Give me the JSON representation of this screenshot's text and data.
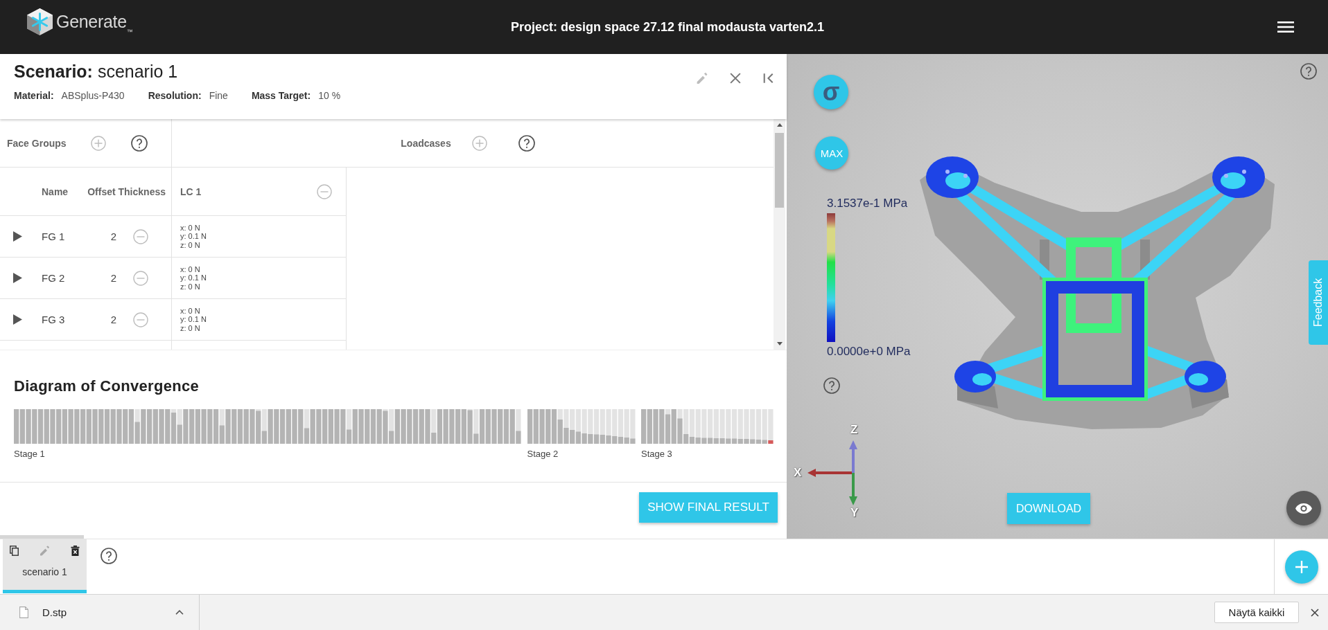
{
  "header": {
    "logo_text": "Generate",
    "logo_mark": "™",
    "title": "Project: design space 27.12 final modausta varten2.1"
  },
  "scenario": {
    "title": "**Scenario:** scenario 1",
    "meta": [
      {
        "label": "Material:",
        "value": "ABSplus-P430"
      },
      {
        "label": "Resolution:",
        "value": "Fine"
      },
      {
        "label": "Mass Target:",
        "value": "10 %"
      }
    ]
  },
  "face_groups": {
    "title": "Face Groups",
    "columns": [
      "Name",
      "Offset Thickness"
    ],
    "rows": [
      {
        "name": "FG 1",
        "offset_thickness": "2",
        "expanded": false
      },
      {
        "name": "FG 2",
        "offset_thickness": "2",
        "expanded": false
      },
      {
        "name": "FG 3",
        "offset_thickness": "2",
        "expanded": false
      }
    ]
  },
  "loadcases": {
    "title": "Loadcases",
    "columns": [
      {
        "label": "LC 1",
        "loads": [
          [
            "x: 0 N",
            "y: 0.1 N",
            "z: 0 N"
          ],
          [
            "x: 0 N",
            "y: 0.1 N",
            "z: 0 N"
          ],
          [
            "x: 0 N",
            "y: 0.1 N",
            "z: 0 N"
          ]
        ]
      }
    ]
  },
  "convergence": {
    "title": "Diagram of Convergence",
    "stages": [
      {
        "label": "Stage 1"
      },
      {
        "label": "Stage 2"
      },
      {
        "label": "Stage 3"
      }
    ],
    "button": "SHOW FINAL RESULT"
  },
  "viewer": {
    "stress_button": "σ",
    "max_button": "MAX",
    "legend": {
      "max_label": "3.1537e-1 MPa",
      "min_label": "0.0000e+0 MPa"
    },
    "axes": {
      "x": "X",
      "y": "Y",
      "z": "Z"
    },
    "download_button": "DOWNLOAD",
    "feedback_tab": "Feedback"
  },
  "scenario_tabs": [
    {
      "label": "scenario 1",
      "selected": true
    }
  ],
  "downloads": {
    "items": [
      {
        "file": "D.stp"
      }
    ],
    "show_all_button": "Näytä kaikki"
  }
}
